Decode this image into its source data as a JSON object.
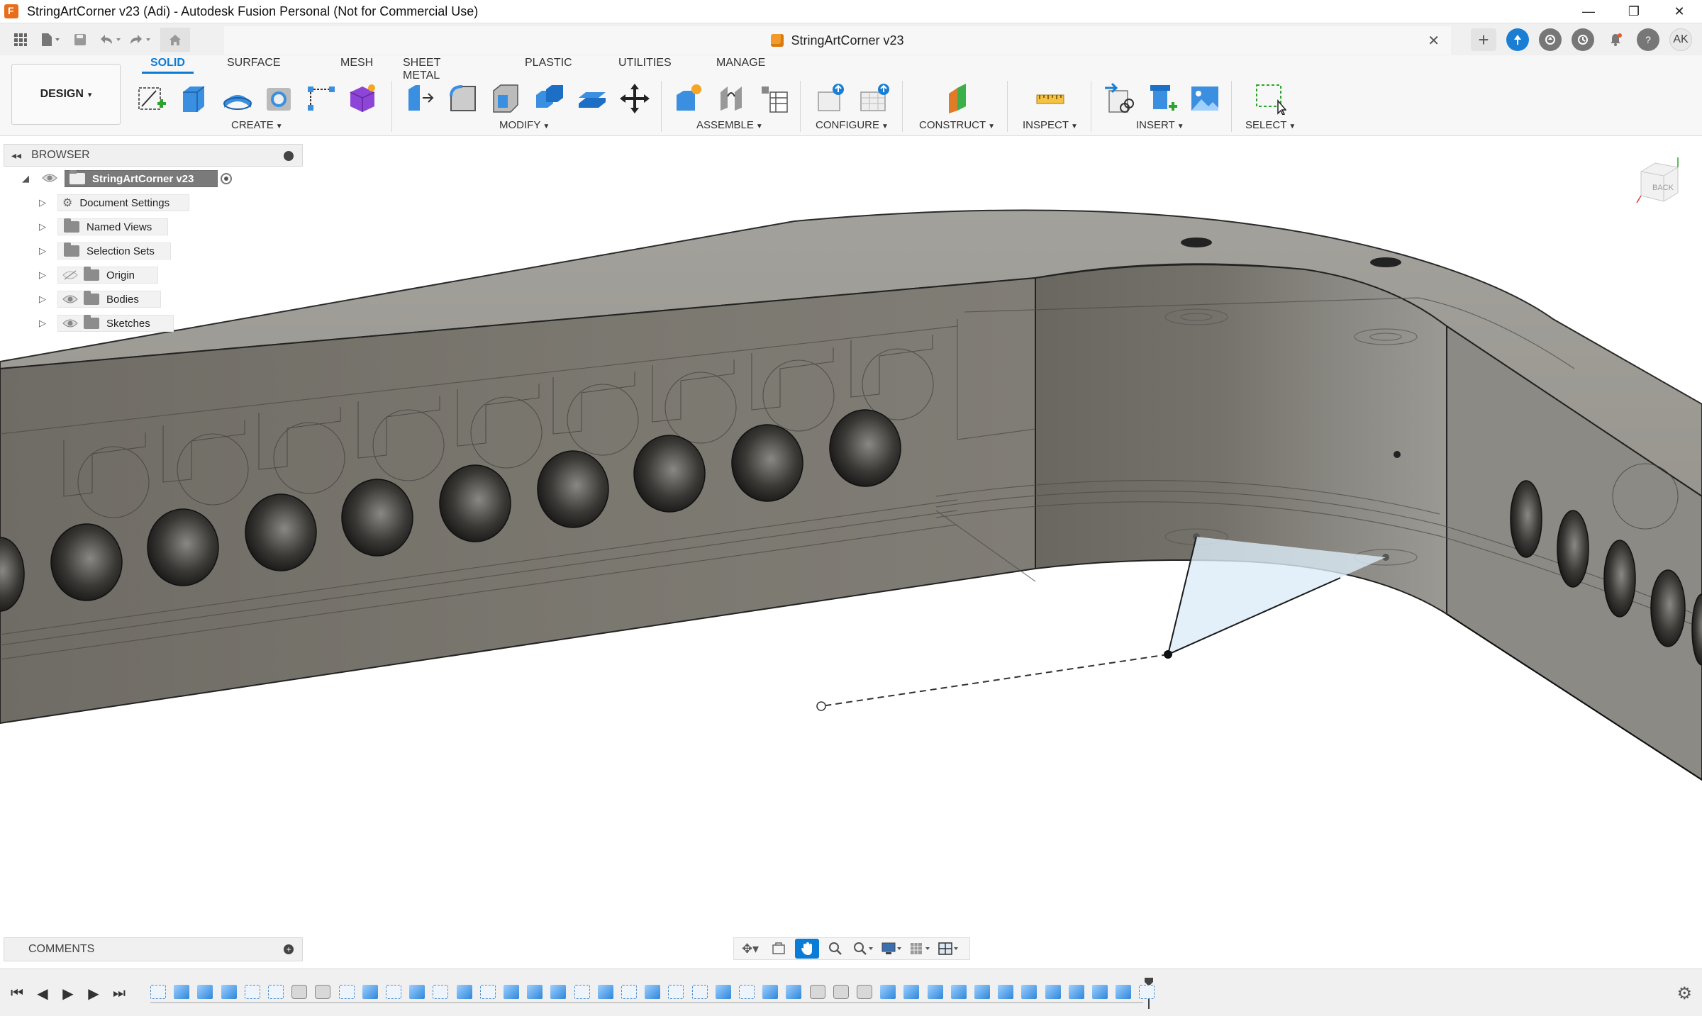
{
  "window": {
    "title": "StringArtCorner v23 (Adi) - Autodesk Fusion Personal (Not for Commercial Use)",
    "min_glyph": "—",
    "restore_glyph": "❐",
    "close_glyph": "✕"
  },
  "document_tab": {
    "name": "StringArtCorner v23",
    "close_glyph": "✕"
  },
  "header_right": {
    "new_tab_glyph": "+",
    "avatar_initials": "AK",
    "help_glyph": "?"
  },
  "workspace": {
    "label": "DESIGN",
    "caret": "▾"
  },
  "ribbon_tabs": [
    {
      "label": "SOLID",
      "active": true
    },
    {
      "label": "SURFACE",
      "active": false
    },
    {
      "label": "MESH",
      "active": false
    },
    {
      "label": "SHEET METAL",
      "active": false
    },
    {
      "label": "PLASTIC",
      "active": false
    },
    {
      "label": "UTILITIES",
      "active": false
    },
    {
      "label": "MANAGE",
      "active": false
    }
  ],
  "ribbon_groups": [
    {
      "label": "CREATE"
    },
    {
      "label": "MODIFY"
    },
    {
      "label": "ASSEMBLE"
    },
    {
      "label": "CONFIGURE"
    },
    {
      "label": "CONSTRUCT"
    },
    {
      "label": "INSPECT"
    },
    {
      "label": "INSERT"
    },
    {
      "label": "SELECT"
    }
  ],
  "browser": {
    "title": "BROWSER",
    "root": "StringArtCorner v23",
    "items": [
      {
        "label": "Document Settings",
        "icon": "gear-icon"
      },
      {
        "label": "Named Views",
        "icon": "folder-icon"
      },
      {
        "label": "Selection Sets",
        "icon": "folder-icon"
      },
      {
        "label": "Origin",
        "icon": "folder-icon",
        "visibility": "hidden"
      },
      {
        "label": "Bodies",
        "icon": "folder-icon",
        "visibility": "visible"
      },
      {
        "label": "Sketches",
        "icon": "folder-icon",
        "visibility": "visible"
      }
    ]
  },
  "viewcube": {
    "face": "BACK"
  },
  "comments": {
    "title": "COMMENTS"
  },
  "colors": {
    "accent": "#0b7cd6",
    "body_face": "#7d7a72",
    "body_top": "#a2a09a",
    "sketch_fill": "#dcecf8"
  },
  "timeline": {
    "features": [
      "sketch",
      "extrude",
      "extrude",
      "extrude",
      "sketch",
      "sketch",
      "hole",
      "hole",
      "sketch",
      "extrude",
      "sketch",
      "extrude",
      "sketch",
      "extrude",
      "sketch",
      "extrude",
      "extrude",
      "extrude",
      "sketch",
      "extrude",
      "sketch",
      "extrude",
      "sketch",
      "sketch",
      "extrude",
      "sketch",
      "extrude",
      "extrude",
      "hole",
      "hole",
      "hole",
      "extrude",
      "extrude",
      "extrude",
      "extrude",
      "extrude",
      "extrude",
      "extrude",
      "extrude",
      "extrude",
      "extrude",
      "extrude",
      "sketch"
    ]
  }
}
